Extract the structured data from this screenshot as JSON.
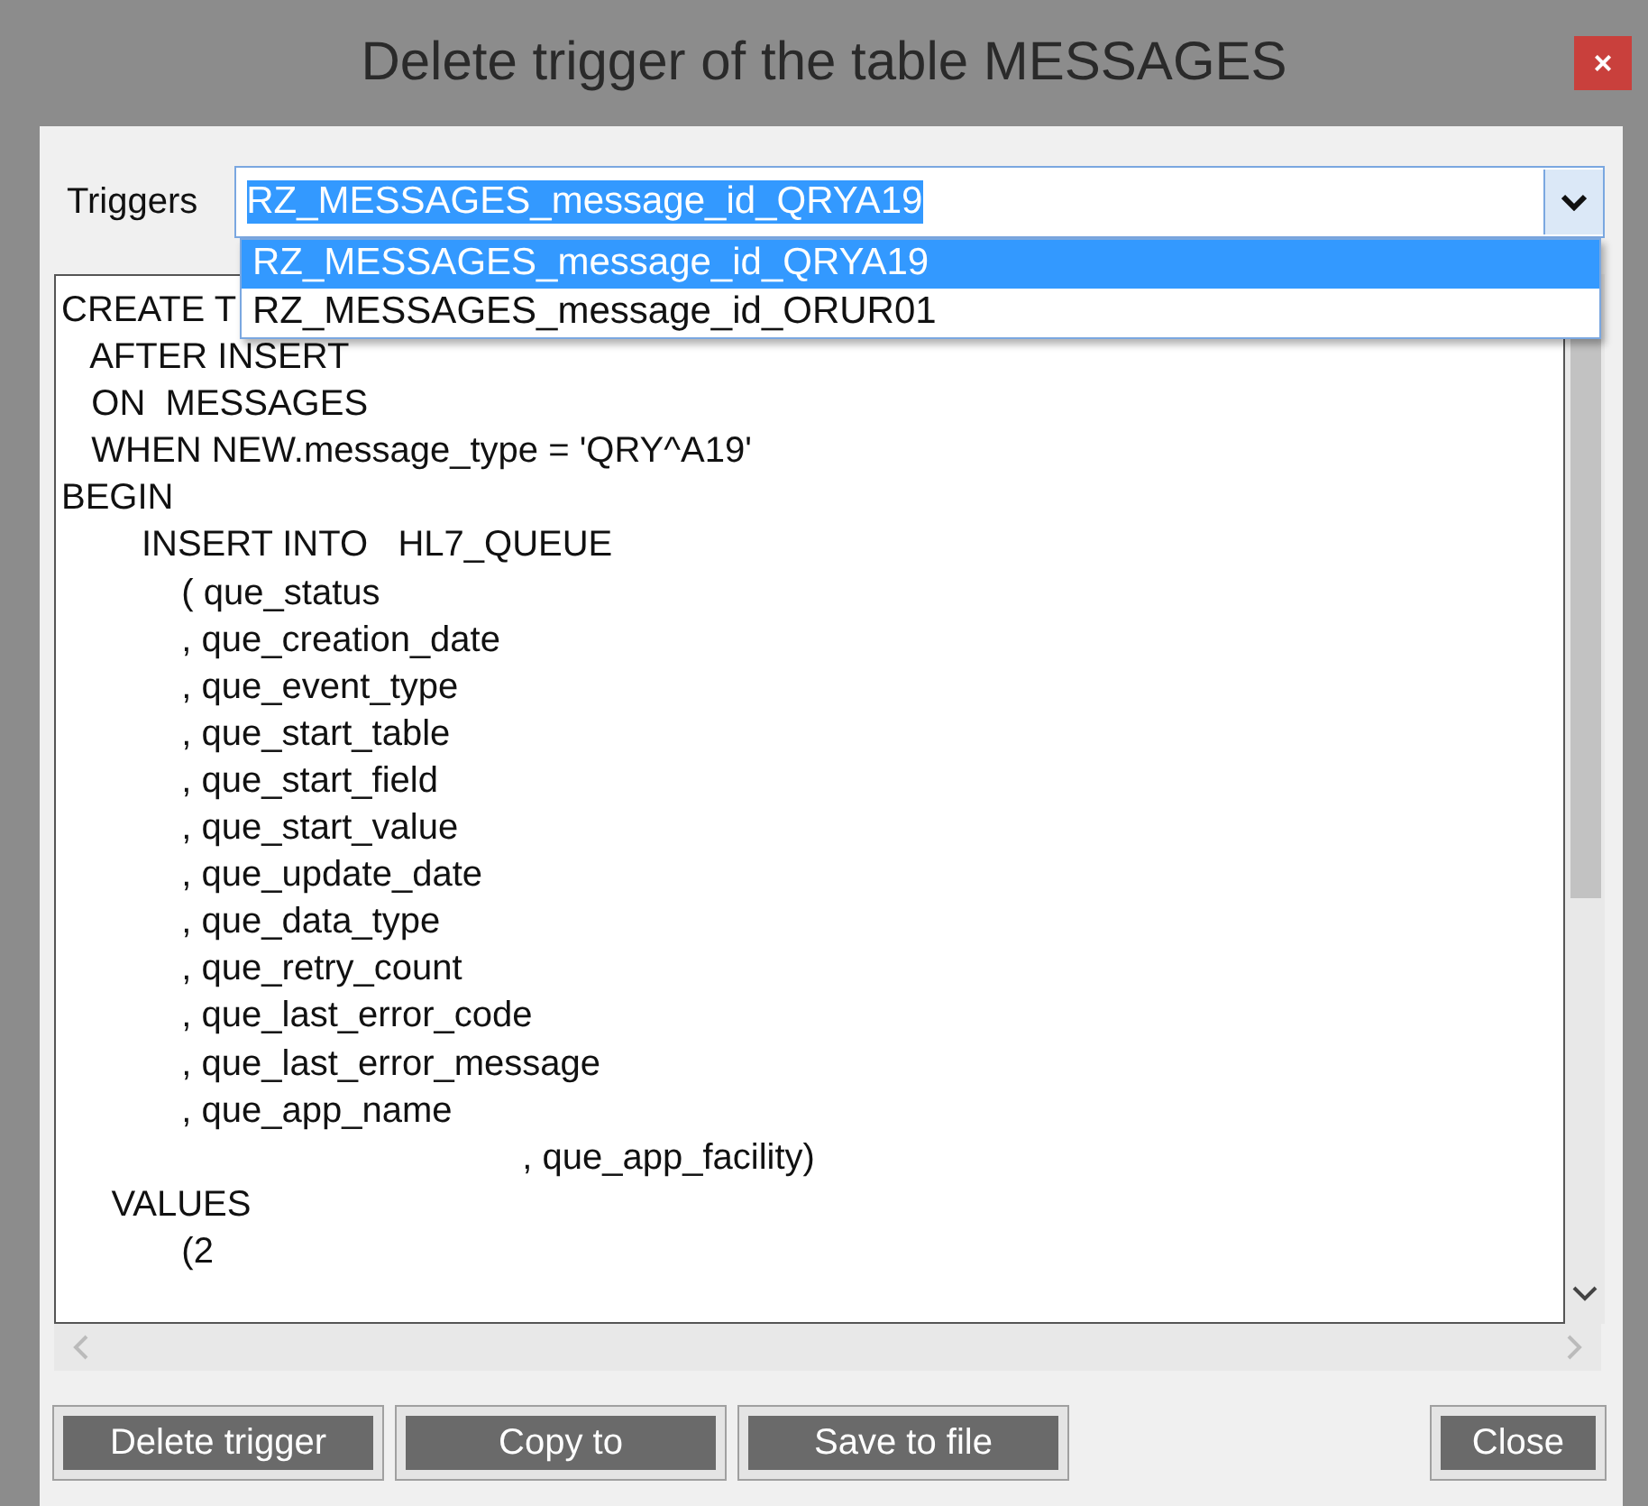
{
  "window": {
    "title": "Delete trigger of the table MESSAGES",
    "close": "×"
  },
  "triggers": {
    "label": "Triggers",
    "value": "RZ_MESSAGES_message_id_QRYA19",
    "expanded": true,
    "options": [
      {
        "label": "RZ_MESSAGES_message_id_QRYA19",
        "selected": true
      },
      {
        "label": "RZ_MESSAGES_message_id_ORUR01",
        "selected": false
      }
    ]
  },
  "code_lines": [
    "CREATE T",
    "   AFTER INSERT",
    "   ON  MESSAGES",
    "   WHEN NEW.message_type = 'QRY^A19'",
    "BEGIN",
    "        INSERT INTO   HL7_QUEUE",
    "            ( que_status",
    "            , que_creation_date",
    "            , que_event_type",
    "            , que_start_table",
    "            , que_start_field",
    "            , que_start_value",
    "            , que_update_date",
    "            , que_data_type",
    "            , que_retry_count",
    "            , que_last_error_code",
    "            , que_last_error_message",
    "            , que_app_name",
    "                                              , que_app_facility)",
    "     VALUES",
    "            (2"
  ],
  "buttons": [
    {
      "label": "Delete trigger"
    },
    {
      "label": "Copy to"
    },
    {
      "label": "Save to file"
    },
    {
      "label": "Close"
    }
  ]
}
